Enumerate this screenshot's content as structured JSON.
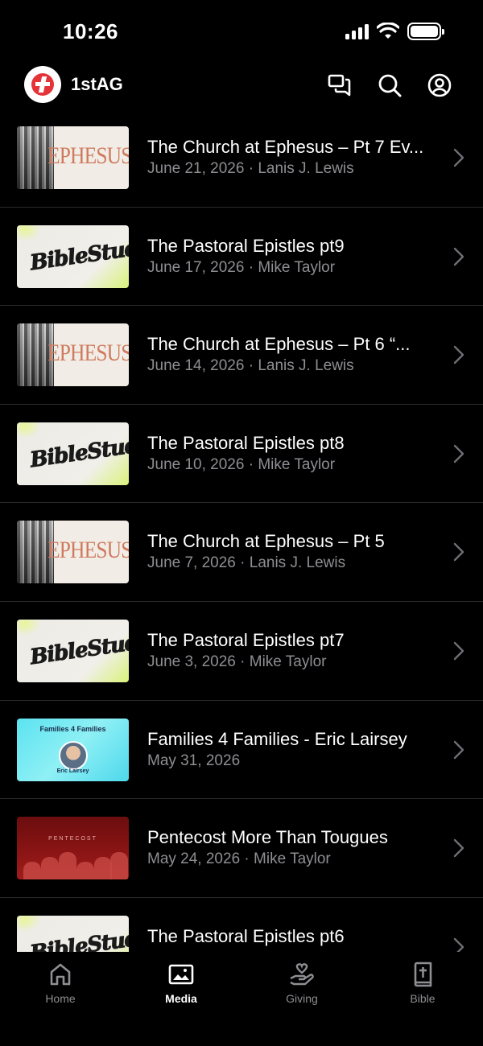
{
  "status_bar": {
    "time": "10:26"
  },
  "header": {
    "app_name": "1stAG"
  },
  "items": [
    {
      "title": "The Church at Ephesus – Pt 7  Ev...",
      "subtitle": "June 21, 2026 · Lanis J. Lewis",
      "thumb": "ephesus"
    },
    {
      "title": "The Pastoral Epistles pt9",
      "subtitle": "June 17, 2026 · Mike Taylor",
      "thumb": "bible-study"
    },
    {
      "title": "The Church at Ephesus – Pt 6  “...",
      "subtitle": "June 14, 2026 · Lanis J. Lewis",
      "thumb": "ephesus"
    },
    {
      "title": "The Pastoral Epistles pt8",
      "subtitle": "June 10, 2026 · Mike Taylor",
      "thumb": "bible-study"
    },
    {
      "title": "The Church at Ephesus – Pt 5",
      "subtitle": "June 7, 2026 · Lanis J. Lewis",
      "thumb": "ephesus"
    },
    {
      "title": "The Pastoral Epistles pt7",
      "subtitle": "June 3, 2026 · Mike Taylor",
      "thumb": "bible-study"
    },
    {
      "title": "Families 4 Families - Eric Lairsey",
      "subtitle": "May 31, 2026",
      "thumb": "families"
    },
    {
      "title": "Pentecost More Than Tougues",
      "subtitle": "May 24, 2026 · Mike Taylor",
      "thumb": "pentecost"
    },
    {
      "title": "The Pastoral Epistles pt6",
      "subtitle": "",
      "thumb": "bible-study"
    }
  ],
  "thumb_text": {
    "ephesus_word": "EPHESUS",
    "bible_study_word": "BibleStudy",
    "families_title": "Families 4 Families",
    "families_name": "Eric Lairsey",
    "pentecost_title": "PENTECOST"
  },
  "tabs": [
    {
      "label": "Home",
      "icon": "home-icon",
      "active": false
    },
    {
      "label": "Media",
      "icon": "media-icon",
      "active": true
    },
    {
      "label": "Giving",
      "icon": "giving-icon",
      "active": false
    },
    {
      "label": "Bible",
      "icon": "bible-icon",
      "active": false
    }
  ],
  "colors": {
    "background": "#000000",
    "text": "#ffffff",
    "secondary_text": "#8e8e93",
    "brand_red": "#e4343a"
  }
}
